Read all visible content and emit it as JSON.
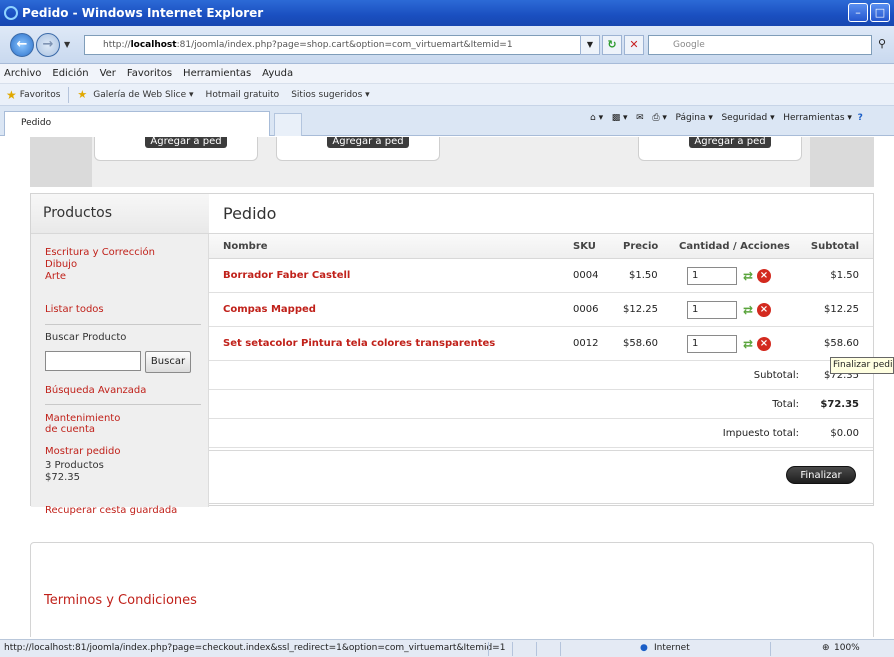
{
  "window": {
    "title": "Pedido - Windows Internet Explorer"
  },
  "address": {
    "url_prefix": "http://",
    "url_host": "localhost",
    "url_rest": ":81/joomla/index.php?page=shop.cart&option=com_virtuemart&Itemid=1",
    "search_placeholder": "Google"
  },
  "menu": [
    "Archivo",
    "Edición",
    "Ver",
    "Favoritos",
    "Herramientas",
    "Ayuda"
  ],
  "favorites": {
    "label": "Favoritos",
    "links": [
      "Galería de Web Slice ▾",
      "Hotmail gratuito",
      "Sitios sugeridos ▾"
    ]
  },
  "tab": {
    "label": "Pedido"
  },
  "commandbar": {
    "pagina": "Página ▾",
    "seguridad": "Seguridad ▾",
    "herramientas": "Herramientas ▾"
  },
  "top_buttons": [
    "Agregar a ped",
    "Agregar a ped",
    "Agregar a ped"
  ],
  "sidebar": {
    "title": "Productos",
    "categories": [
      "Escritura y Corrección",
      "Dibujo",
      "Arte"
    ],
    "list_all": "Listar todos",
    "search_label": "Buscar Producto",
    "search_button": "Buscar",
    "advanced_search": "Búsqueda Avanzada",
    "account_line1": "Mantenimiento",
    "account_line2": "de cuenta",
    "show_order": "Mostrar pedido",
    "cart_count": "3 Productos",
    "cart_total": "$72.35",
    "saved_cart": "Recuperar cesta guardada"
  },
  "cart": {
    "title": "Pedido",
    "headers": {
      "name": "Nombre",
      "sku": "SKU",
      "price": "Precio",
      "qty": "Cantidad / Acciones",
      "subtotal": "Subtotal"
    },
    "items": [
      {
        "name": "Borrador Faber Castell",
        "sku": "0004",
        "price": "$1.50",
        "qty": "1",
        "subtotal": "$1.50"
      },
      {
        "name": "Compas Mapped",
        "sku": "0006",
        "price": "$12.25",
        "qty": "1",
        "subtotal": "$12.25"
      },
      {
        "name": "Set setacolor Pintura tela colores transparentes",
        "sku": "0012",
        "price": "$58.60",
        "qty": "1",
        "subtotal": "$58.60"
      }
    ],
    "summary": {
      "subtotal_label": "Subtotal:",
      "subtotal": "$72.35",
      "total_label": "Total:",
      "total": "$72.35",
      "tax_label": "Impuesto total:",
      "tax": "$0.00"
    },
    "checkout_button": "Finalizar",
    "checkout_tooltip": "Finalizar pedido"
  },
  "footer": {
    "terms": "Terminos y Condiciones"
  },
  "statusbar": {
    "url": "http://localhost:81/joomla/index.php?page=checkout.index&ssl_redirect=1&option=com_virtuemart&Itemid=1",
    "zone": "Internet",
    "zoom": "100%"
  },
  "colors": {
    "link_red": "#c0211a",
    "titlebar_blue": "#1a4fc0"
  }
}
